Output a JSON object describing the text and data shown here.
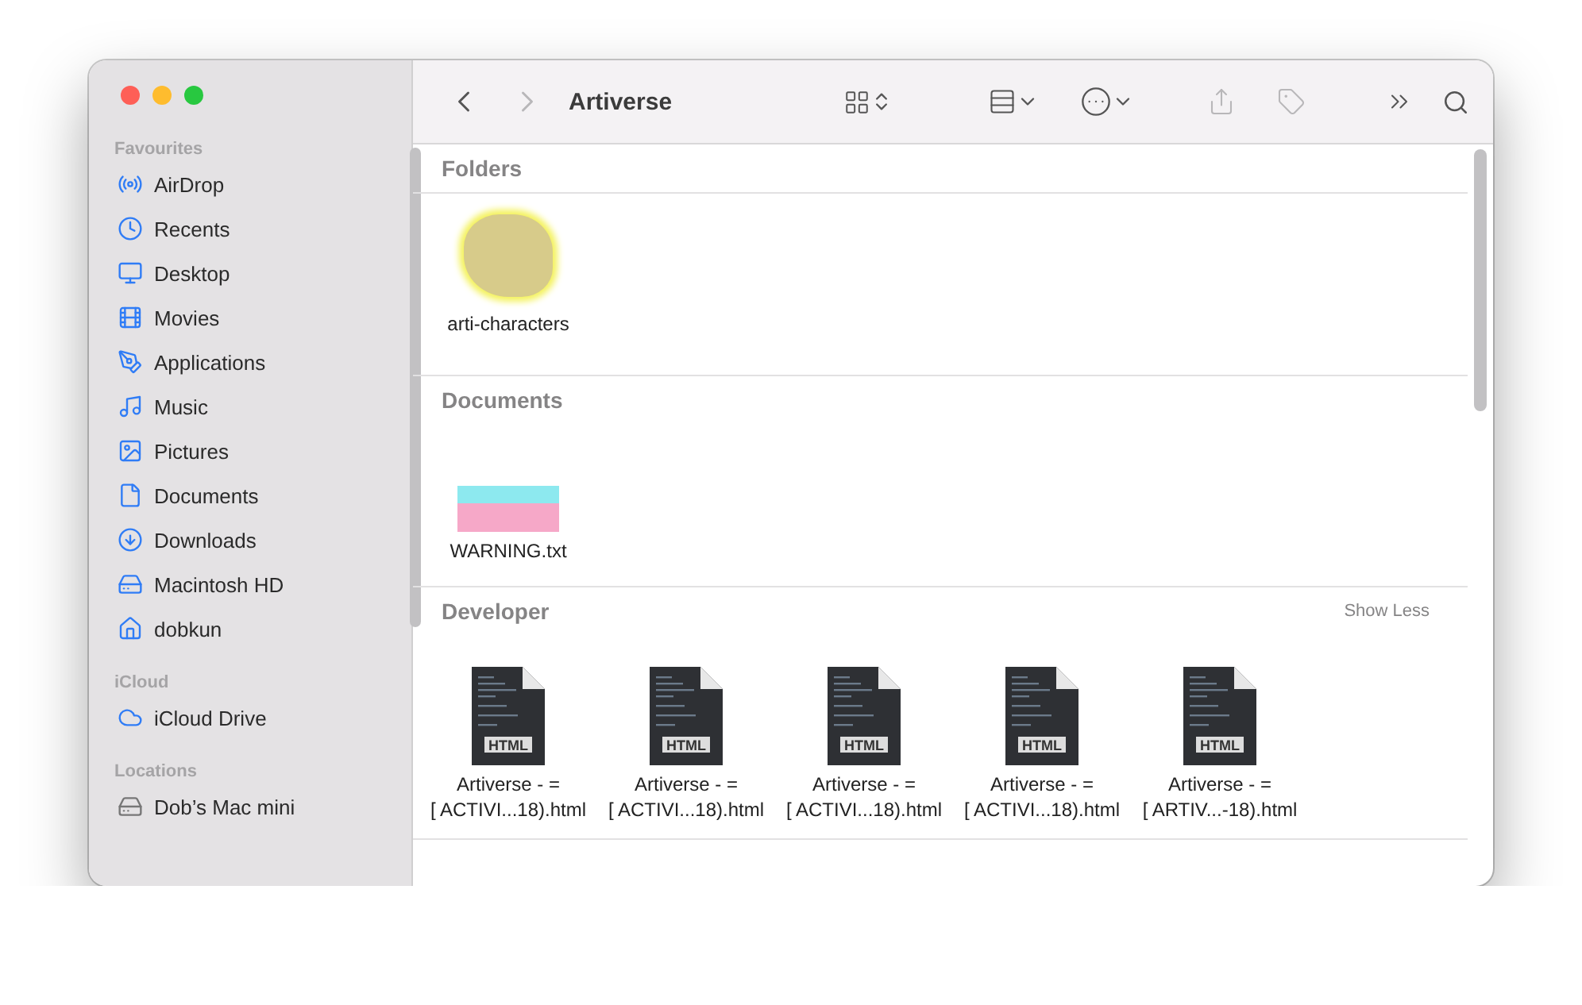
{
  "window": {
    "title": "Artiverse"
  },
  "sidebar": {
    "sections": [
      {
        "title": "Favourites",
        "items": [
          {
            "label": "AirDrop",
            "kind": "airdrop"
          },
          {
            "label": "Recents",
            "kind": "recents"
          },
          {
            "label": "Desktop",
            "kind": "desktop"
          },
          {
            "label": "Movies",
            "kind": "movies"
          },
          {
            "label": "Applications",
            "kind": "applications"
          },
          {
            "label": "Music",
            "kind": "music"
          },
          {
            "label": "Pictures",
            "kind": "pictures"
          },
          {
            "label": "Documents",
            "kind": "documents"
          },
          {
            "label": "Downloads",
            "kind": "downloads"
          },
          {
            "label": "Macintosh HD",
            "kind": "disk"
          },
          {
            "label": "dobkun",
            "kind": "home"
          }
        ]
      },
      {
        "title": "iCloud",
        "items": [
          {
            "label": "iCloud Drive",
            "kind": "cloud"
          }
        ]
      },
      {
        "title": "Locations",
        "items": [
          {
            "label": "Dob’s Mac mini",
            "kind": "computer"
          }
        ]
      }
    ]
  },
  "groups": [
    {
      "title": "Folders",
      "items": [
        {
          "name": "arti-characters",
          "kind": "folder"
        }
      ]
    },
    {
      "title": "Documents",
      "items": [
        {
          "name": "WARNING.txt",
          "kind": "picture"
        }
      ]
    },
    {
      "title": "Developer",
      "action": "Show Less",
      "items": [
        {
          "name": "Artiverse - = [ ACTIVI...18).html",
          "kind": "html",
          "badge": "HTML"
        },
        {
          "name": "Artiverse - = [ ACTIVI...18).html",
          "kind": "html",
          "badge": "HTML"
        },
        {
          "name": "Artiverse - = [ ACTIVI...18).html",
          "kind": "html",
          "badge": "HTML"
        },
        {
          "name": "Artiverse - = [ ACTIVI...18).html",
          "kind": "html",
          "badge": "HTML"
        },
        {
          "name": "Artiverse - = [ ARTIV...-18).html",
          "kind": "html",
          "badge": "HTML"
        }
      ]
    }
  ]
}
